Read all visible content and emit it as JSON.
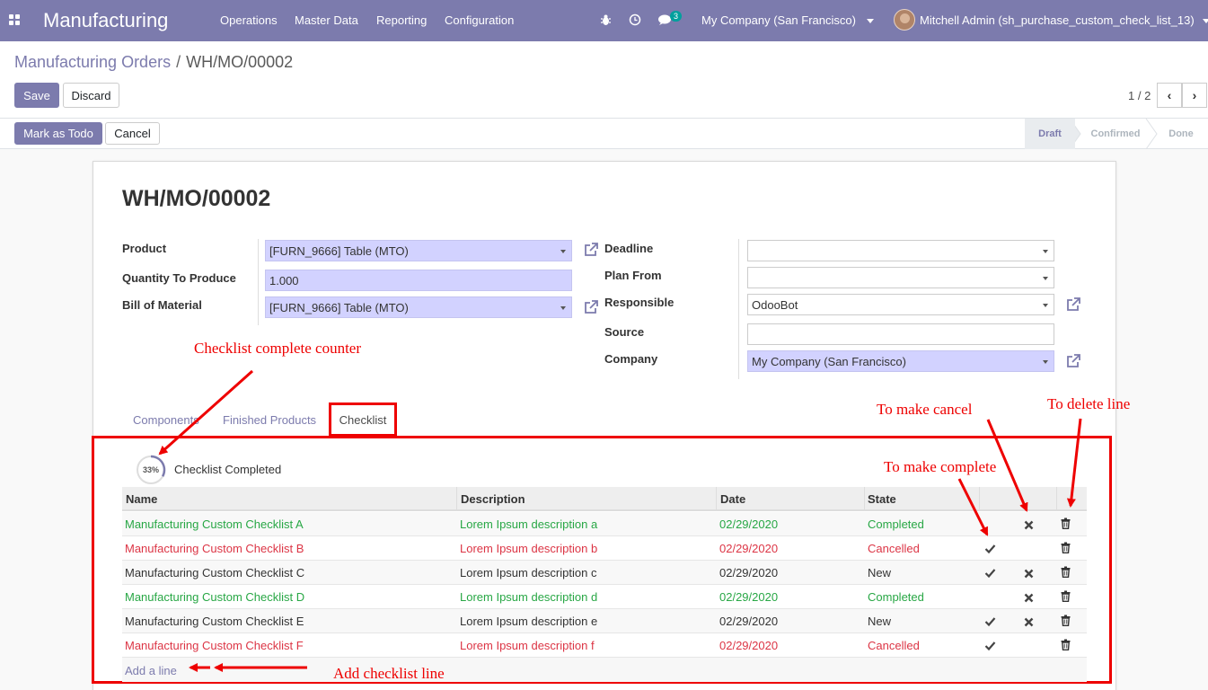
{
  "navbar": {
    "app_name": "Manufacturing",
    "menus": [
      "Operations",
      "Master Data",
      "Reporting",
      "Configuration"
    ],
    "chat_badge": "3",
    "company": "My Company (San Francisco)",
    "user": "Mitchell Admin (sh_purchase_custom_check_list_13)",
    "icons": [
      "apps-icon",
      "bug-icon",
      "clock-icon",
      "chat-icon"
    ]
  },
  "breadcrumb": {
    "parent": "Manufacturing Orders",
    "separator": "/",
    "current": "WH/MO/00002"
  },
  "buttons": {
    "save": "Save",
    "discard": "Discard",
    "mark_todo": "Mark as Todo",
    "cancel": "Cancel"
  },
  "pager": {
    "value": "1 / 2"
  },
  "statusbar": [
    "Draft",
    "Confirmed",
    "Done"
  ],
  "form": {
    "title": "WH/MO/00002",
    "labels": {
      "product": "Product",
      "qty": "Quantity To Produce",
      "bom": "Bill of Material",
      "deadline": "Deadline",
      "plan_from": "Plan From",
      "responsible": "Responsible",
      "source": "Source",
      "company": "Company"
    },
    "values": {
      "product": "[FURN_9666] Table (MTO)",
      "qty": "1.000",
      "bom": "[FURN_9666] Table (MTO)",
      "deadline": "",
      "plan_from": "",
      "responsible": "OdooBot",
      "source": "",
      "company": "My Company (San Francisco)"
    }
  },
  "tabs": [
    "Components",
    "Finished Products",
    "Checklist"
  ],
  "checklist": {
    "progress_label": "33%",
    "progress_value": 0.33,
    "completed_label": "Checklist Completed",
    "columns": [
      "Name",
      "Description",
      "Date",
      "State"
    ],
    "rows": [
      {
        "name": "Manufacturing Custom Checklist A",
        "description": "Lorem Ipsum description a",
        "date": "02/29/2020",
        "state": "Completed",
        "color": "#28a745",
        "complete_btn": false,
        "cancel_btn": true
      },
      {
        "name": "Manufacturing Custom Checklist B",
        "description": "Lorem Ipsum description b",
        "date": "02/29/2020",
        "state": "Cancelled",
        "color": "#dc3545",
        "complete_btn": true,
        "cancel_btn": false
      },
      {
        "name": "Manufacturing Custom Checklist C",
        "description": "Lorem Ipsum description c",
        "date": "02/29/2020",
        "state": "New",
        "color": "#333333",
        "complete_btn": true,
        "cancel_btn": true
      },
      {
        "name": "Manufacturing Custom Checklist D",
        "description": "Lorem Ipsum description d",
        "date": "02/29/2020",
        "state": "Completed",
        "color": "#28a745",
        "complete_btn": false,
        "cancel_btn": true
      },
      {
        "name": "Manufacturing Custom Checklist E",
        "description": "Lorem Ipsum description e",
        "date": "02/29/2020",
        "state": "New",
        "color": "#333333",
        "complete_btn": true,
        "cancel_btn": true
      },
      {
        "name": "Manufacturing Custom Checklist F",
        "description": "Lorem Ipsum description f",
        "date": "02/29/2020",
        "state": "Cancelled",
        "color": "#dc3545",
        "complete_btn": true,
        "cancel_btn": false
      }
    ],
    "add_line": "Add a line"
  },
  "annotations": {
    "counter": "Checklist complete counter",
    "cancel": "To make cancel",
    "delete": "To delete line",
    "complete": "To make complete",
    "add": "Add checklist line"
  },
  "colors": {
    "brand": "#7c7bad",
    "annotation": "#ee0000",
    "completed": "#28a745",
    "cancelled": "#dc3545"
  }
}
